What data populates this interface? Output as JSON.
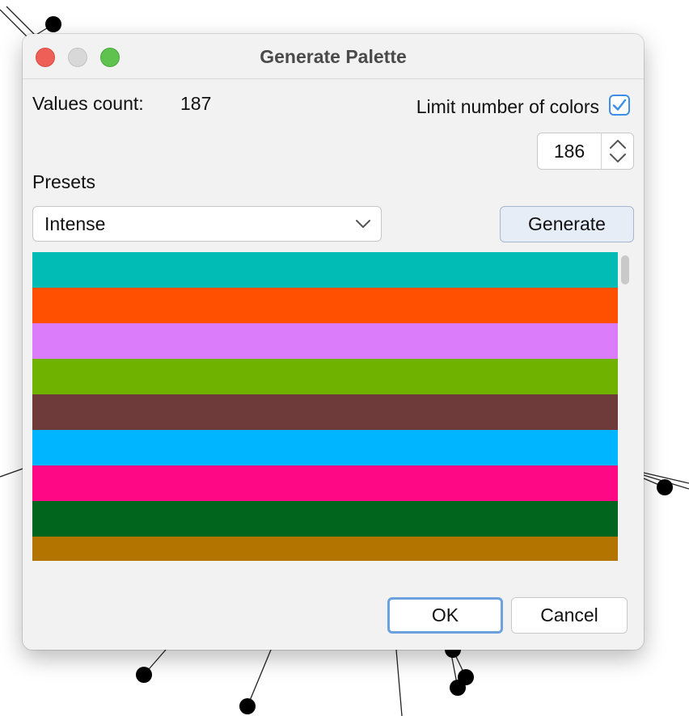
{
  "window": {
    "title": "Generate Palette"
  },
  "values": {
    "label": "Values count:",
    "count": "187"
  },
  "limit": {
    "label": "Limit number of colors",
    "checked": true,
    "value": "186"
  },
  "presets": {
    "label": "Presets",
    "selected": "Intense"
  },
  "actions": {
    "generate": "Generate",
    "ok": "OK",
    "cancel": "Cancel"
  },
  "palette": {
    "colors": [
      "#00bcb5",
      "#ff4f00",
      "#db7cfa",
      "#6fb300",
      "#6e3b3a",
      "#00b5ff",
      "#ff0885",
      "#02651e",
      "#b37500"
    ]
  },
  "icons": {
    "checkbox": "checkmark-icon",
    "spinner": "stepper-arrows-icon",
    "dropdown": "chevron-down-icon"
  }
}
